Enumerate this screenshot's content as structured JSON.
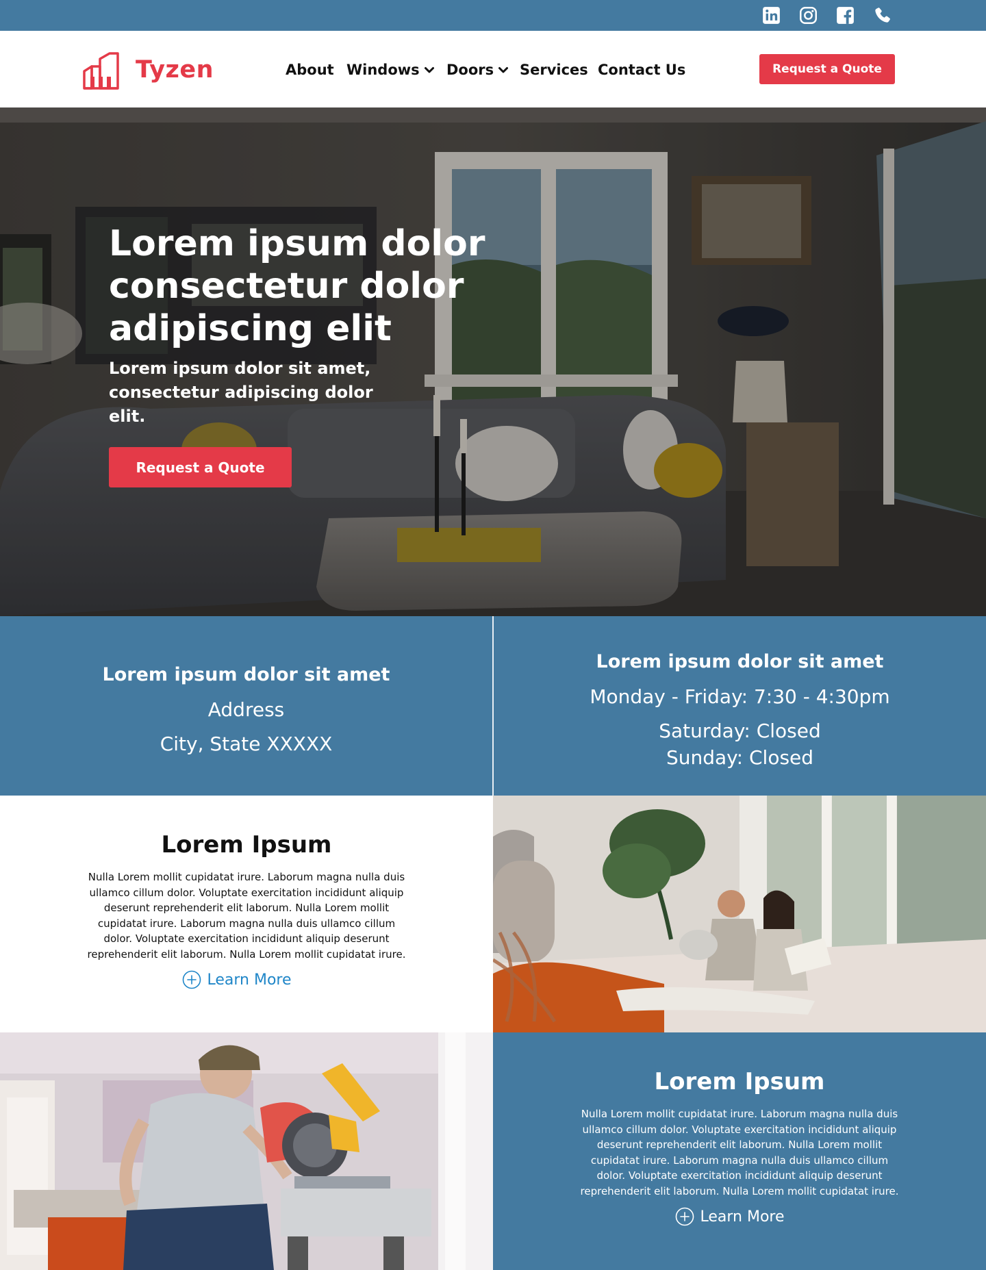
{
  "topbar": {
    "icons": [
      "linkedin-icon",
      "instagram-icon",
      "facebook-icon",
      "phone-icon"
    ],
    "color": "#447aa0"
  },
  "header": {
    "brand": "Tyzen",
    "nav": [
      {
        "label": "About"
      },
      {
        "label": "Windows",
        "dropdown": true
      },
      {
        "label": "Doors",
        "dropdown": true
      },
      {
        "label": "Services"
      },
      {
        "label": "Contact Us"
      }
    ],
    "cta": "Request a Quote"
  },
  "hero": {
    "title": "Lorem ipsum dolor consectetur dolor adipiscing elit",
    "subtitle": "Lorem ipsum dolor sit amet, consectetur adipiscing dolor elit.",
    "cta": "Request a Quote"
  },
  "info": {
    "left": {
      "title": "Lorem ipsum dolor sit amet",
      "line1": "Address",
      "line2": "City, State XXXXX"
    },
    "right": {
      "title": "Lorem ipsum dolor sit amet",
      "line1": "Monday - Friday: 7:30 - 4:30pm",
      "line2": "Saturday: Closed",
      "line3": "Sunday: Closed"
    }
  },
  "features": [
    {
      "title": "Lorem Ipsum",
      "body": "Nulla Lorem mollit cupidatat irure. Laborum magna nulla duis ullamco cillum dolor. Voluptate exercitation incididunt aliquip deserunt reprehenderit elit laborum. Nulla Lorem mollit cupidatat irure. Laborum magna nulla duis ullamco cillum dolor. Voluptate exercitation incididunt aliquip deserunt reprehenderit elit laborum. Nulla Lorem mollit cupidatat irure.",
      "link": "Learn More"
    },
    {
      "title": "Lorem Ipsum",
      "body": "Nulla Lorem mollit cupidatat irure. Laborum magna nulla duis ullamco cillum dolor. Voluptate exercitation incididunt aliquip deserunt reprehenderit elit laborum. Nulla Lorem mollit cupidatat irure. Laborum magna nulla duis ullamco cillum dolor. Voluptate exercitation incididunt aliquip deserunt reprehenderit elit laborum. Nulla Lorem mollit cupidatat irure.",
      "link": "Learn More"
    }
  ],
  "colors": {
    "brand_red": "#e43a48",
    "brand_blue": "#447aa0",
    "link_blue": "#1f86c8"
  }
}
